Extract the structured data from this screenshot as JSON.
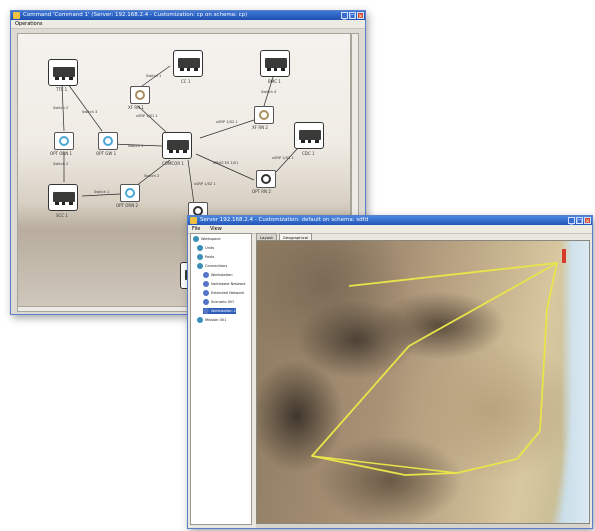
{
  "window1": {
    "title": "Command 'Command 1' (Server: 192.168.2.4 - Customization: cp on schema: cp)",
    "menu": [
      "Operations"
    ],
    "nodes": {
      "ttc1": "TTC 1",
      "cc1": "CC 1",
      "bmc1": "BMC 1",
      "cdc1": "CDC 1",
      "comcor1": "COMCOR 1",
      "scc1": "SCC 1",
      "xr1": "XF RN 1",
      "xr2": "XF RN 2",
      "opt1": "OPT ORN 1",
      "optgw1": "OPT GW 1",
      "opt2": "OPT ORN 2",
      "opt3": "OPT RN 2",
      "bottom": "MPOR"
    },
    "edges": {
      "e1": "Switch 1",
      "e2": "Switch 2",
      "e3": "Switch 3",
      "e4": "Switch 4",
      "e5": "xSRP 1/S1 1",
      "e6": "xSRP 1/S2 1",
      "e7": "Switch 1",
      "e8": "Switch 2",
      "e9": "MBUS ES 1/S1",
      "e10": "xSRP 1/S3 1",
      "e11": "Switch 2",
      "e12": "Switch 1",
      "e13": "xSRP 1/S2 1"
    }
  },
  "window2": {
    "title": "Server 192.168.2.4 - Customization: default on schema: sdfd",
    "menu": [
      "File",
      "View"
    ],
    "tree": [
      "Workspace",
      "Units",
      "Posts",
      "Connections",
      "Workstation",
      "Northwest Network",
      "Extended Network",
      "Scenario ISO",
      "Workstation 2",
      "Mission 001"
    ],
    "tabs": [
      "Layout",
      "Geographical"
    ]
  },
  "colors": {
    "title_bar": "#1e4fb0",
    "route": "#e8e44a",
    "selection": "#2d5fb8",
    "fiber_icon": "#4aa8d8"
  }
}
